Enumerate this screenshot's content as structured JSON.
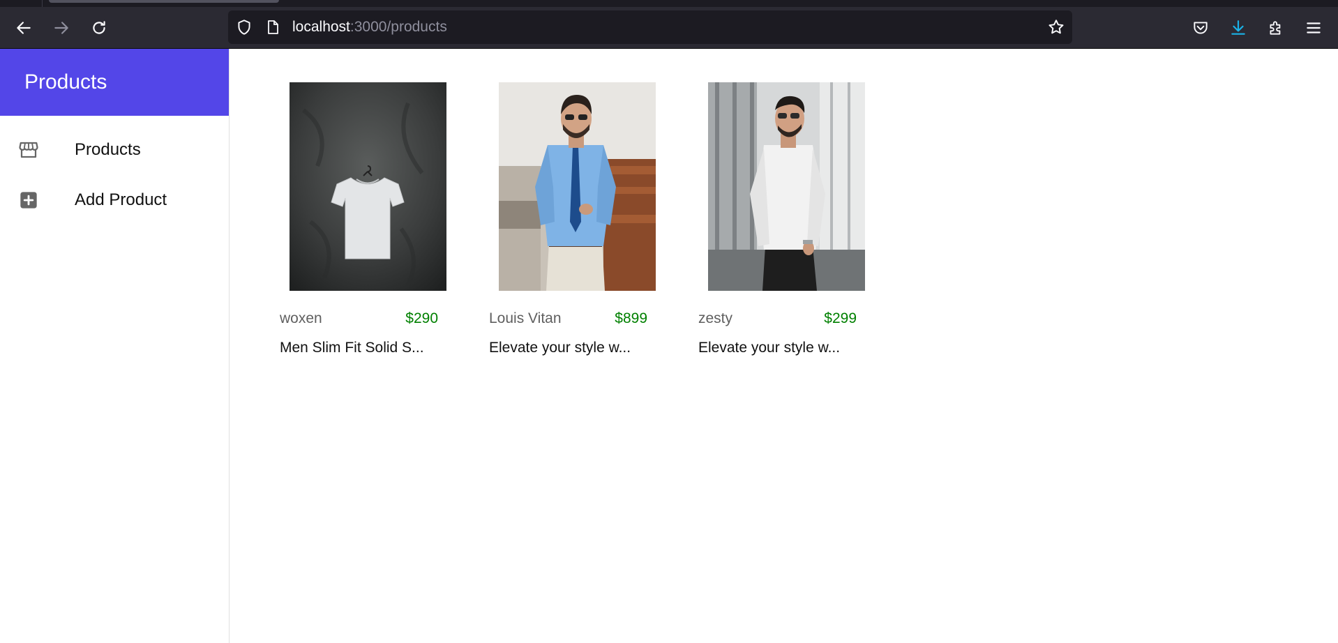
{
  "browser": {
    "url_host": "localhost",
    "url_path": ":3000/products",
    "accent_download": "#1ab3e8"
  },
  "sidebar": {
    "title": "Products",
    "header_color": "#5346e8",
    "items": [
      {
        "label": "Products",
        "icon": "store-icon"
      },
      {
        "label": "Add Product",
        "icon": "plus-square-icon"
      }
    ]
  },
  "products": [
    {
      "brand": "woxen",
      "price": "$290",
      "description": "Men Slim Fit Solid S...",
      "image": "white-tshirt-on-hanger"
    },
    {
      "brand": "Louis Vitan",
      "price": "$899",
      "description": "Elevate your style w...",
      "image": "man-blue-shirt-tie"
    },
    {
      "brand": "zesty",
      "price": "$299",
      "description": "Elevate your style w...",
      "image": "man-white-shirt"
    }
  ],
  "colors": {
    "price": "#008000",
    "brand": "#5f5f5f"
  }
}
